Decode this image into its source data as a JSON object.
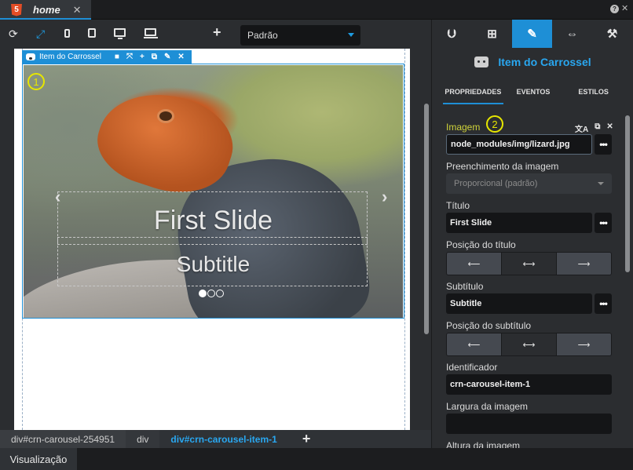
{
  "document_tab": {
    "icon": "5",
    "title": "home",
    "close": "✕"
  },
  "window_controls": {
    "help": "?",
    "close": "✕"
  },
  "toolbar": {
    "refresh_icon": "⟳",
    "expand_icon": "⤢",
    "add_icon": "+",
    "theme_select_value": "Padrão"
  },
  "selection_toolbar": {
    "label": "Item do Carrossel",
    "lock_icon": "🔒",
    "fullscreen_icon": "⤧",
    "add_icon": "+",
    "copy_icon": "⧉",
    "magic_icon": "✎",
    "close_icon": "✕"
  },
  "slide": {
    "title": "First Slide",
    "subtitle": "Subtitle",
    "prev_arrow": "‹",
    "next_arrow": "›",
    "indicators": 3,
    "active_indicator": 1
  },
  "markers": {
    "one": "1",
    "two": "2"
  },
  "breadcrumb": {
    "items": [
      "div#crn-carousel-254951",
      "div",
      "div#crn-carousel-item-1"
    ],
    "add": "+"
  },
  "statusbar": {
    "tab": "Visualização"
  },
  "panel": {
    "tabs": [
      "⮋",
      "⊞",
      "✎",
      "⇔",
      "⚒"
    ],
    "component_title": "Item do Carrossel",
    "subtabs": [
      "PROPRIEDADES",
      "EVENTOS",
      "ESTILOS"
    ],
    "fields": {
      "image_label": "Imagem",
      "image_value": "node_modules/img/lizard.jpg",
      "image_fill_label": "Preenchimento da imagem",
      "image_fill_value": "Proporcional (padrão)",
      "title_label": "Título",
      "title_value": "First Slide",
      "title_pos_label": "Posição do título",
      "subtitle_label": "Subtítulo",
      "subtitle_value": "Subtitle",
      "subtitle_pos_label": "Posição do subtítulo",
      "id_label": "Identificador",
      "id_value": "crn-carousel-item-1",
      "width_label": "Largura da imagem",
      "width_value": "",
      "next_label": "Altura da imagem"
    },
    "more_button": "•••",
    "field_icons": [
      "文A",
      "⧉",
      "✕"
    ],
    "align_buttons": [
      "⟵",
      "⟷",
      "⟶"
    ]
  },
  "colors": {
    "accent": "#1e8fd6",
    "highlight": "#cfd33a",
    "bg": "#2b2d30"
  }
}
